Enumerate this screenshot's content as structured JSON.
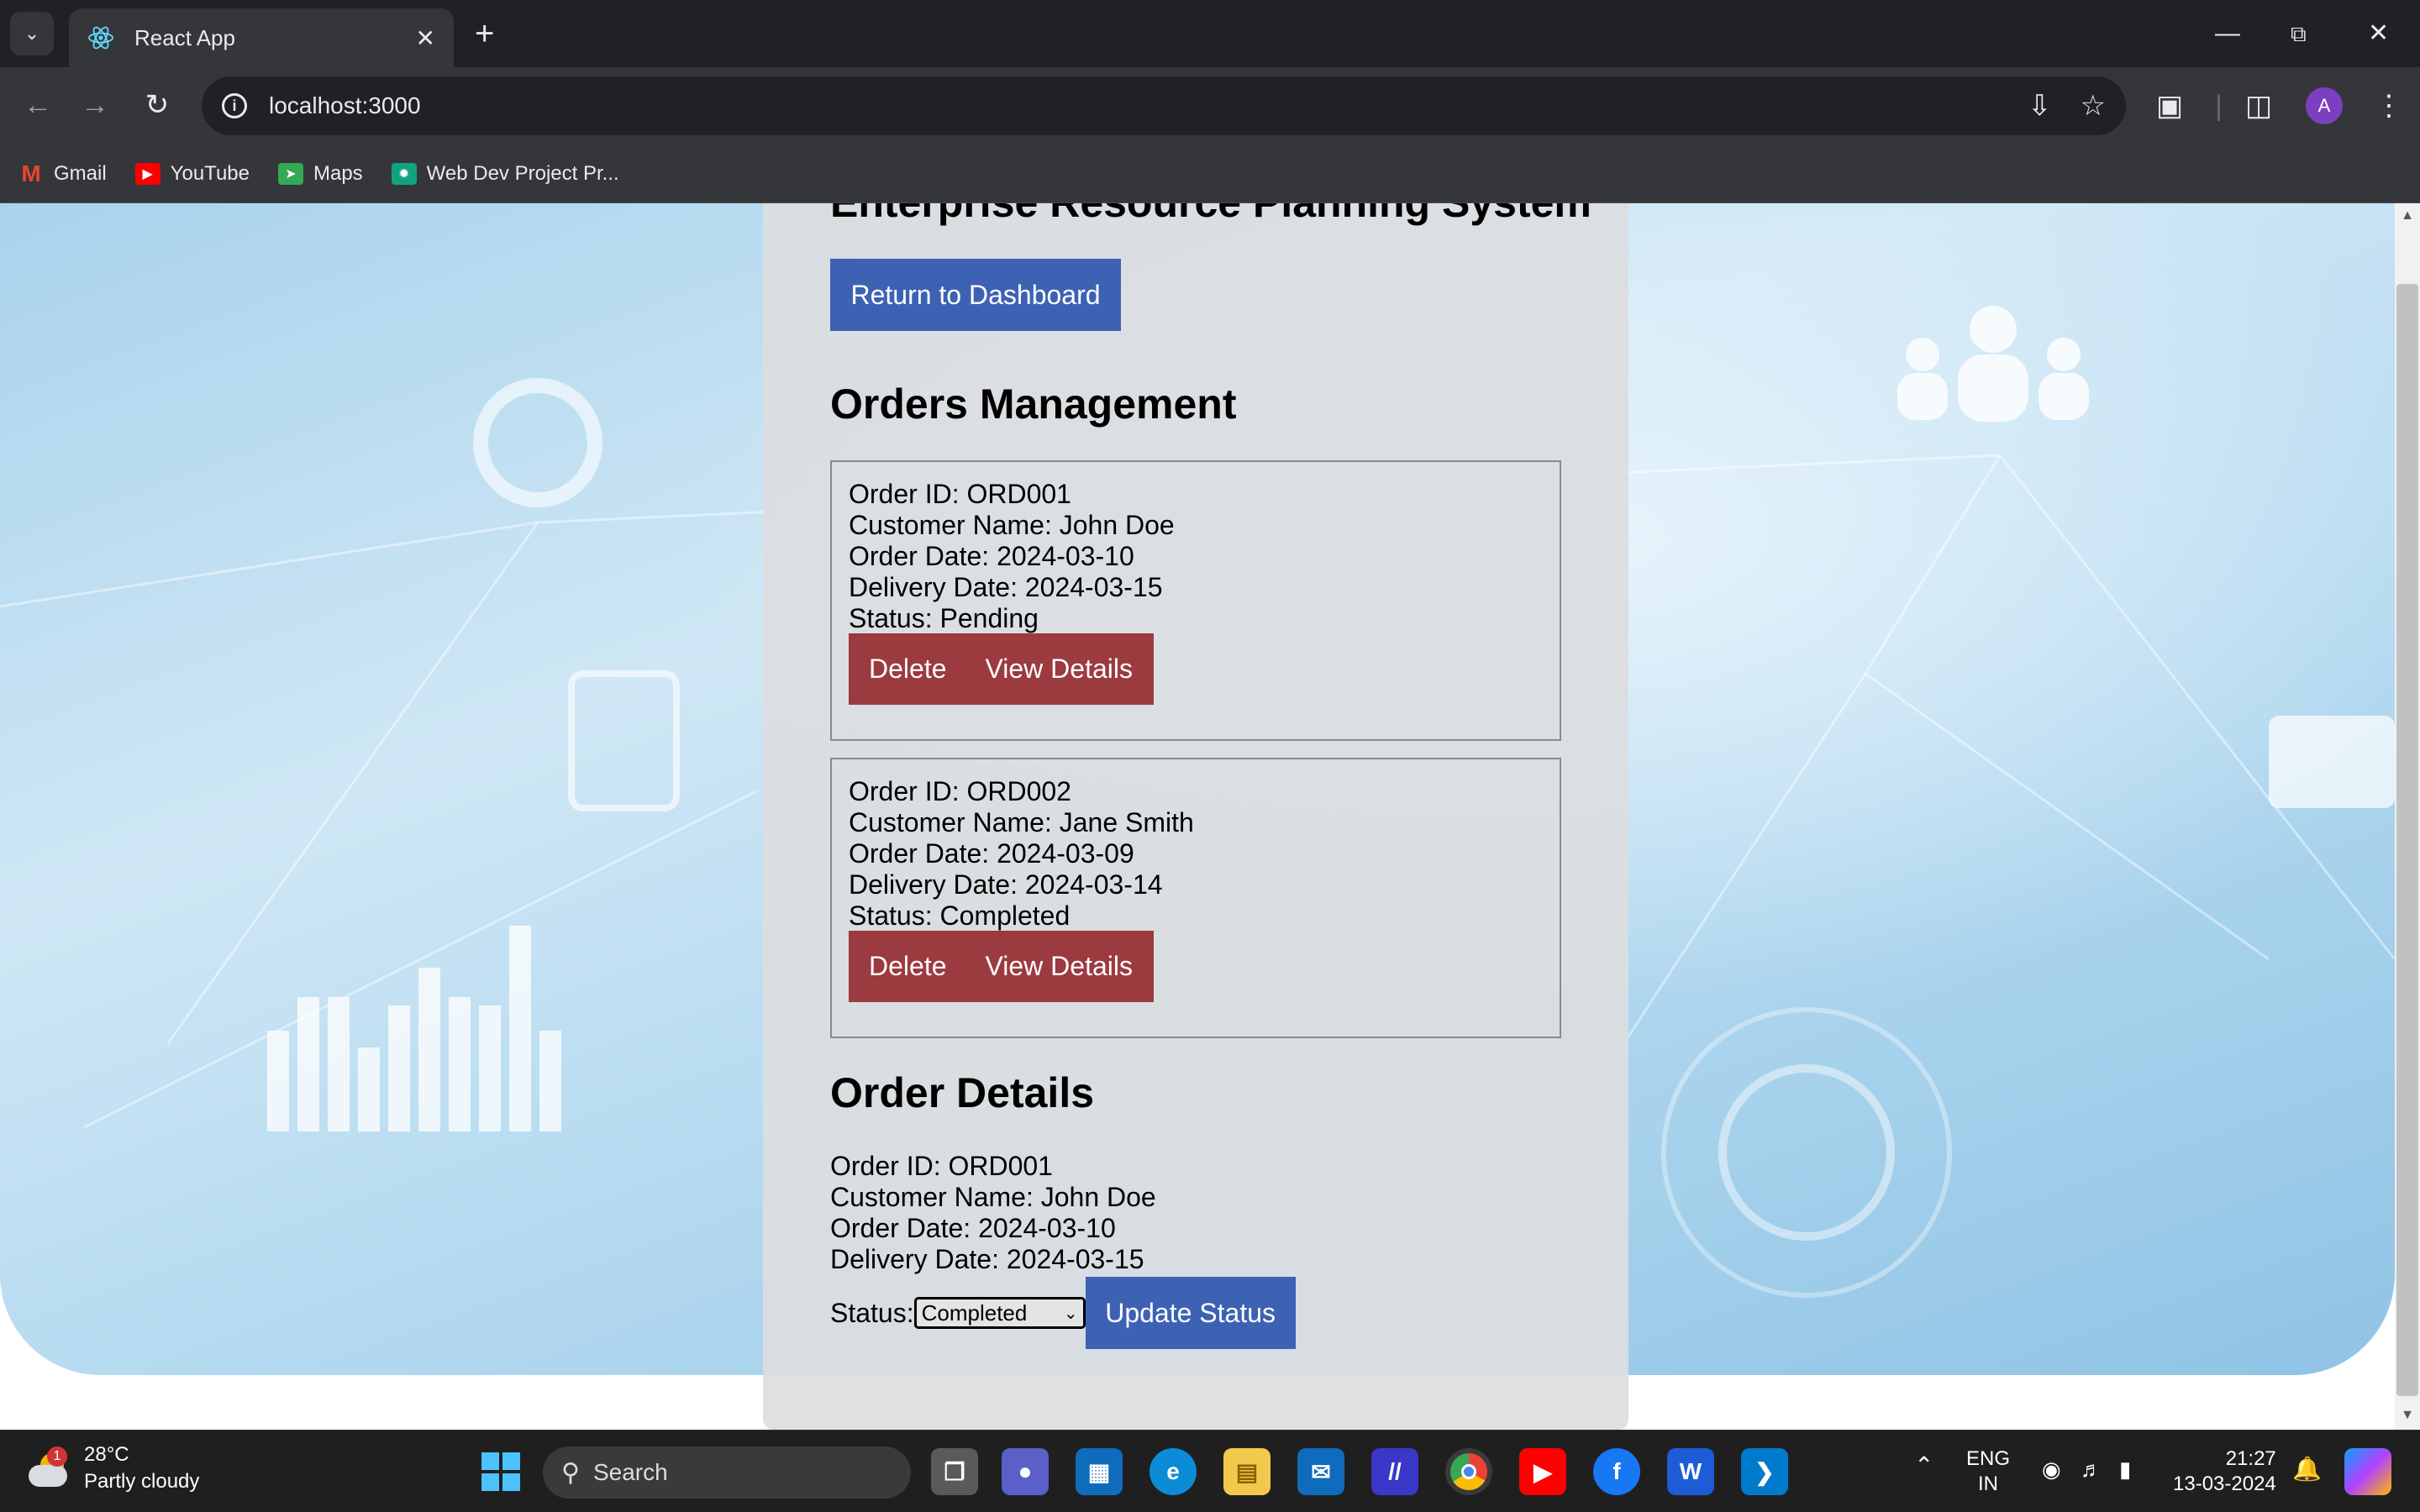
{
  "browser": {
    "tab_title": "React App",
    "url": "localhost:3000",
    "bookmarks": [
      {
        "label": "Gmail",
        "icon": "gmail-icon",
        "color": "#ea4335"
      },
      {
        "label": "YouTube",
        "icon": "youtube-icon",
        "color": "#ff0000"
      },
      {
        "label": "Maps",
        "icon": "maps-icon",
        "color": "#34a853"
      },
      {
        "label": "Web Dev Project Pr...",
        "icon": "chatgpt-icon",
        "color": "#10a37f"
      }
    ],
    "profile_initial": "A"
  },
  "page": {
    "app_title": "Enterprise Resource Planning System",
    "return_button": "Return to Dashboard",
    "orders_heading": "Orders Management",
    "orders": [
      {
        "id": "Order ID: ORD001",
        "customer": "Customer Name: John Doe",
        "order_date": "Order Date: 2024-03-10",
        "delivery_date": "Delivery Date: 2024-03-15",
        "status": "Status: Pending",
        "delete_label": "Delete",
        "view_label": "View Details"
      },
      {
        "id": "Order ID: ORD002",
        "customer": "Customer Name: Jane Smith",
        "order_date": "Order Date: 2024-03-09",
        "delivery_date": "Delivery Date: 2024-03-14",
        "status": "Status: Completed",
        "delete_label": "Delete",
        "view_label": "View Details"
      }
    ],
    "details_heading": "Order Details",
    "details": {
      "id": "Order ID: ORD001",
      "customer": "Customer Name: John Doe",
      "order_date": "Order Date: 2024-03-10",
      "delivery_date": "Delivery Date: 2024-03-15",
      "status_label": "Status:",
      "status_value": "Completed",
      "update_button": "Update Status"
    },
    "colors": {
      "primary": "#3d62b4",
      "danger": "#9b3a3f"
    }
  },
  "taskbar": {
    "weather_temp": "28°C",
    "weather_desc": "Partly cloudy",
    "weather_badge": "1",
    "search_placeholder": "Search",
    "lang_top": "ENG",
    "lang_bottom": "IN",
    "time": "21:27",
    "date": "13-03-2024"
  }
}
